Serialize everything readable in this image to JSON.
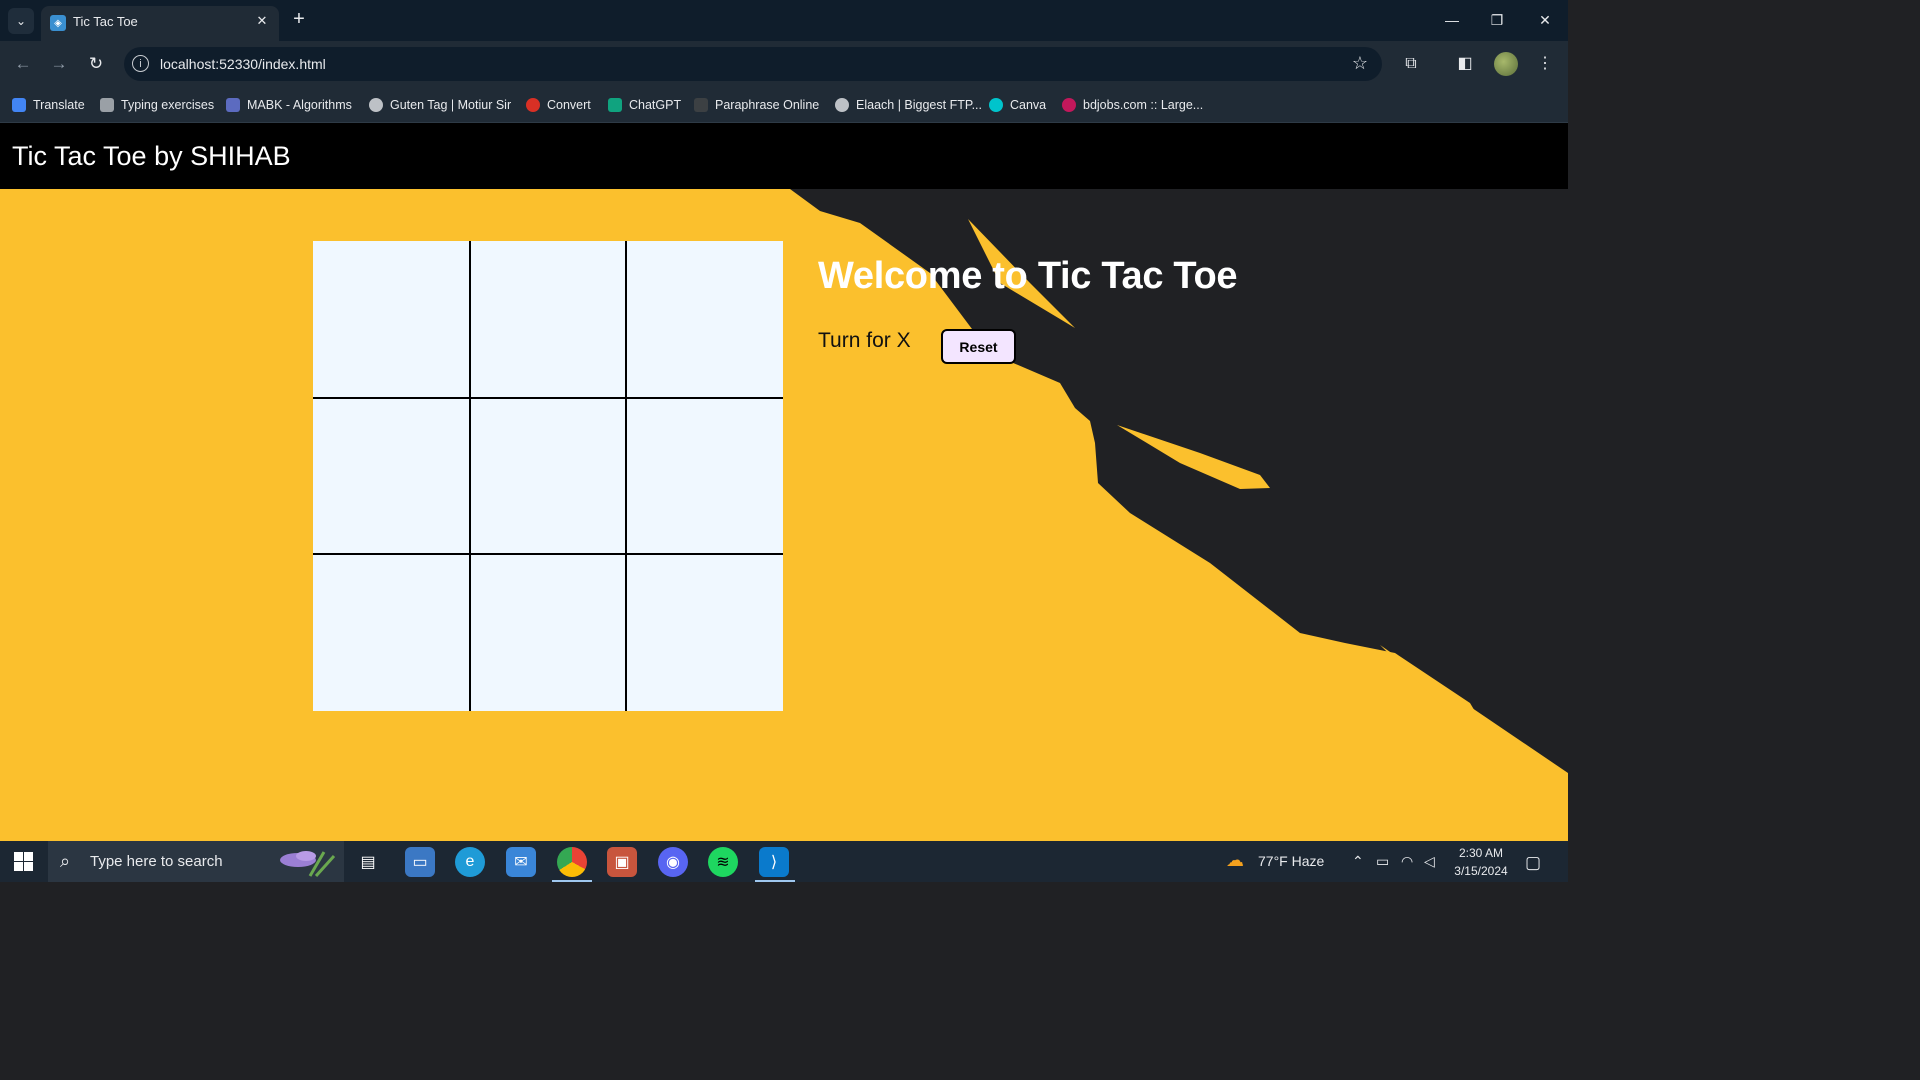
{
  "browser": {
    "tab_title": "Tic Tac Toe",
    "url": "localhost:52330/index.html",
    "bookmarks": [
      {
        "label": "Translate",
        "color": "#4285f4"
      },
      {
        "label": "Typing exercises",
        "color": "#9aa0a6"
      },
      {
        "label": "MABK - Algorithms",
        "color": "#5c6bc0"
      },
      {
        "label": "Guten Tag | Motiur Sir",
        "color": "#bdc1c6"
      },
      {
        "label": "Convert",
        "color": "#d93025"
      },
      {
        "label": "ChatGPT",
        "color": "#10a37f"
      },
      {
        "label": "Paraphrase Online",
        "color": "#3c4043"
      },
      {
        "label": "Elaach | Biggest FTP...",
        "color": "#bdc1c6"
      },
      {
        "label": "Canva",
        "color": "#00c4cc"
      },
      {
        "label": "bdjobs.com :: Large...",
        "color": "#c2185b"
      }
    ]
  },
  "page": {
    "header_title": "Tic Tac Toe by SHIHAB",
    "welcome": "Welcome to Tic Tac Toe",
    "turn_text": "Turn for X",
    "reset_label": "Reset",
    "board": [
      "",
      "",
      "",
      "",
      "",
      "",
      "",
      "",
      ""
    ],
    "colors": {
      "accent": "#fbc02d",
      "dark": "#202124",
      "board": "#f0f8ff"
    }
  },
  "taskbar": {
    "search_placeholder": "Type here to search",
    "weather": "77°F  Haze",
    "time": "2:30 AM",
    "date": "3/15/2024"
  }
}
